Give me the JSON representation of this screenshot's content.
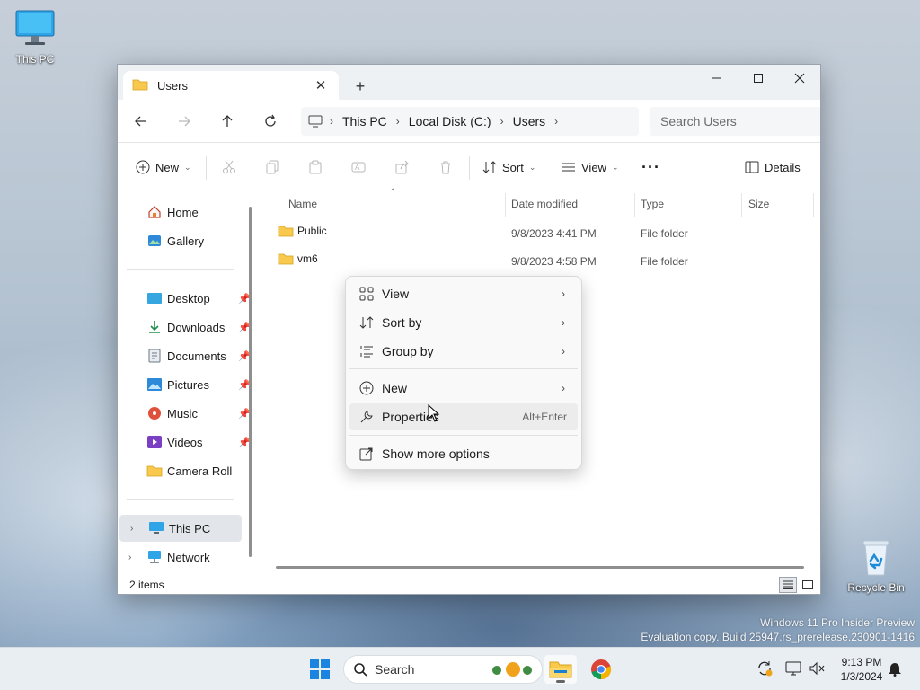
{
  "desktop": {
    "this_pc_label": "This PC",
    "recycle_bin_label": "Recycle Bin",
    "watermark_line1": "Windows 11 Pro Insider Preview",
    "watermark_line2": "Evaluation copy. Build 25947.rs_prerelease.230901-1416"
  },
  "window": {
    "tab_title": "Users",
    "new_tab": "+",
    "breadcrumb": [
      "This PC",
      "Local Disk (C:)",
      "Users"
    ],
    "search_placeholder": "Search Users"
  },
  "toolbar": {
    "new_label": "New",
    "sort_label": "Sort",
    "view_label": "View",
    "more_label": "···",
    "details_label": "Details"
  },
  "nav": {
    "home": "Home",
    "gallery": "Gallery",
    "pinned": [
      "Desktop",
      "Downloads",
      "Documents",
      "Pictures",
      "Music",
      "Videos",
      "Camera Roll"
    ],
    "this_pc": "This PC",
    "network": "Network"
  },
  "columns": {
    "name": "Name",
    "date": "Date modified",
    "type": "Type",
    "size": "Size"
  },
  "files": [
    {
      "name": "Public",
      "date": "9/8/2023 4:41 PM",
      "type": "File folder"
    },
    {
      "name": "vm6",
      "date": "9/8/2023 4:58 PM",
      "type": "File folder"
    }
  ],
  "status": {
    "count": "2 items"
  },
  "context_menu": {
    "view": "View",
    "sort_by": "Sort by",
    "group_by": "Group by",
    "new": "New",
    "properties": "Properties",
    "properties_shortcut": "Alt+Enter",
    "more_options": "Show more options"
  },
  "taskbar": {
    "search_label": "Search",
    "time": "9:13 PM",
    "date": "1/3/2024"
  },
  "colors": {
    "accent": "#0067c0",
    "folder": "#f8c94c",
    "taskbar": "#e9eef3"
  }
}
